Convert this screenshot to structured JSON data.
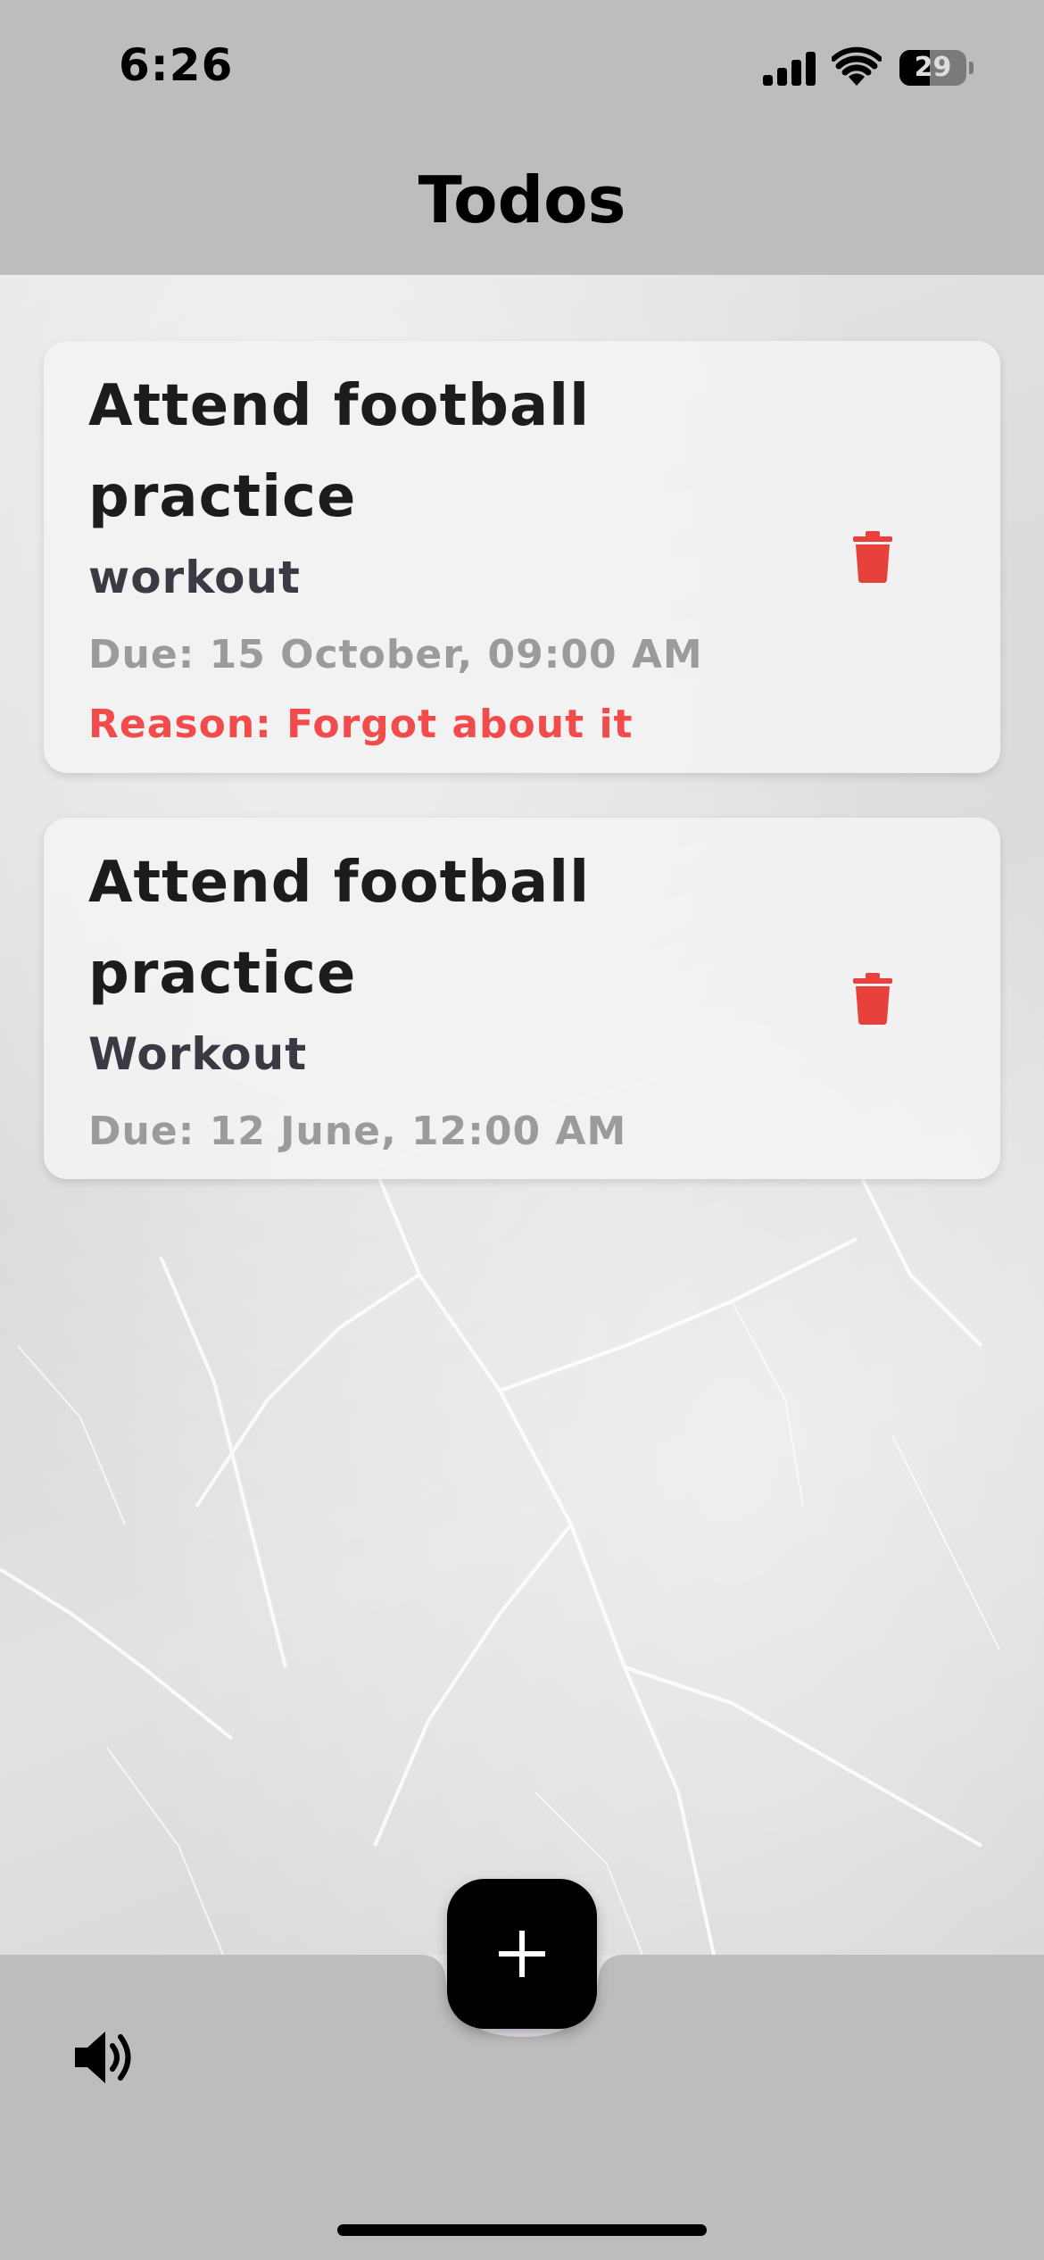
{
  "status_bar": {
    "time": "6:26",
    "battery": "29"
  },
  "nav": {
    "title": "Todos"
  },
  "todos": [
    {
      "title": "Attend football practice",
      "category": "workout",
      "due": "Due: 15 October, 09:00 AM",
      "reason": "Reason: Forgot about it"
    },
    {
      "title": "Attend football practice",
      "category": "Workout",
      "due": "Due: 12 June, 12:00 AM"
    }
  ],
  "icons": {
    "delete": "trash-icon",
    "add": "plus-icon",
    "sound": "speaker-icon"
  },
  "colors": {
    "delete": "#e8403a",
    "reason": "#f24b4b",
    "fab": "#000000",
    "bar": "#bdbdbd"
  }
}
